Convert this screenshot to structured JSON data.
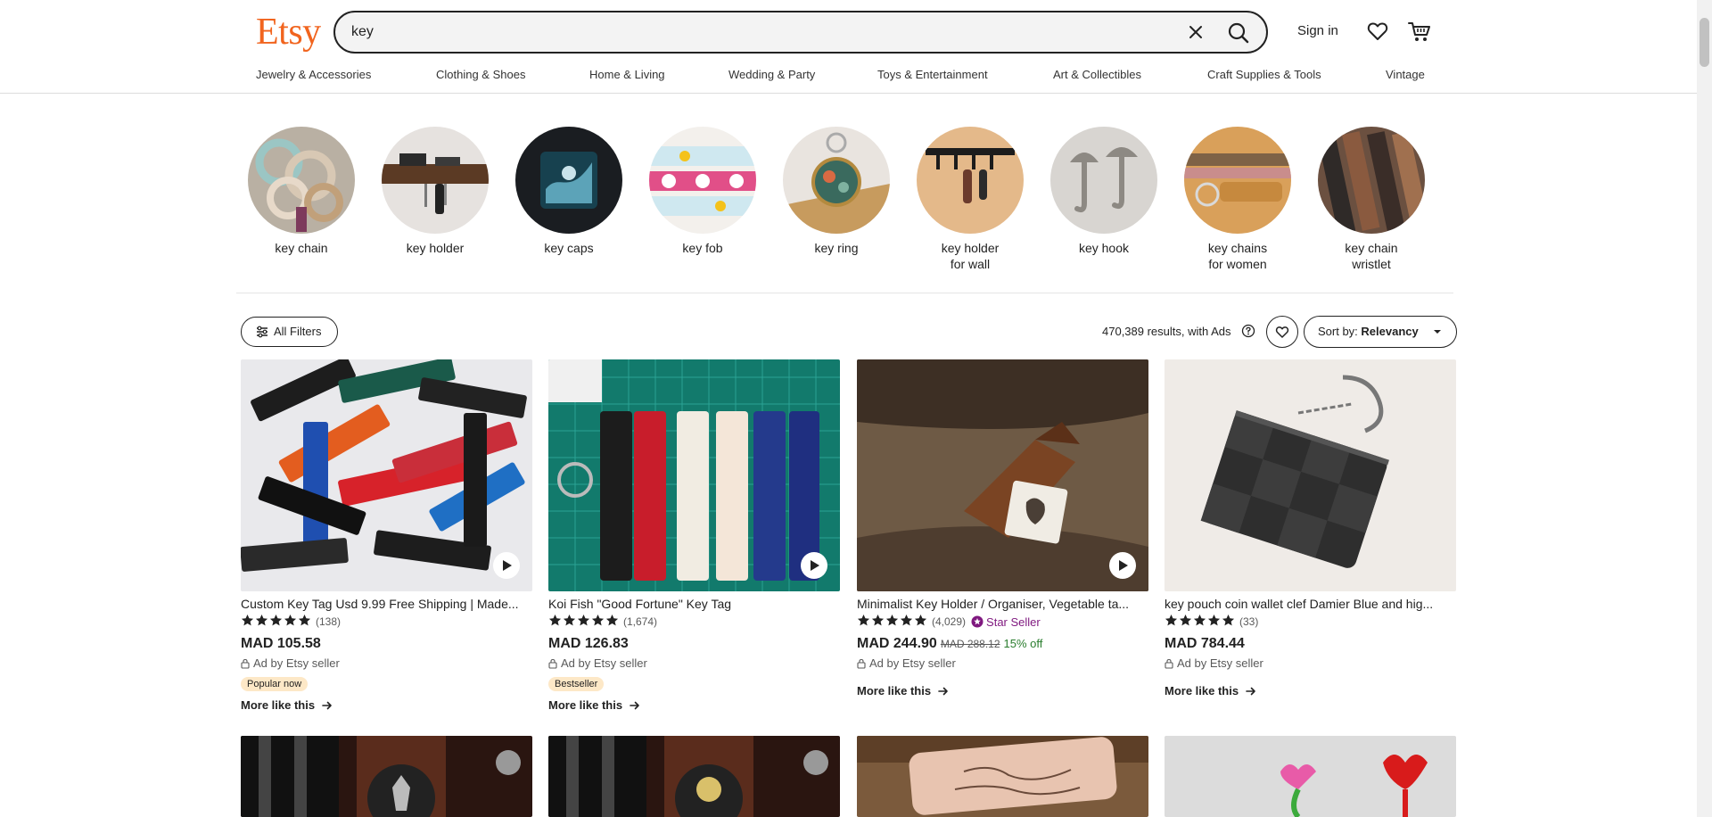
{
  "header": {
    "logo": "Etsy",
    "search_value": "key",
    "signin_label": "Sign in"
  },
  "nav": [
    "Jewelry & Accessories",
    "Clothing & Shoes",
    "Home & Living",
    "Wedding & Party",
    "Toys & Entertainment",
    "Art & Collectibles",
    "Craft Supplies & Tools",
    "Vintage"
  ],
  "categories": [
    {
      "line1": "key chain",
      "line2": ""
    },
    {
      "line1": "key holder",
      "line2": ""
    },
    {
      "line1": "key caps",
      "line2": ""
    },
    {
      "line1": "key fob",
      "line2": ""
    },
    {
      "line1": "key ring",
      "line2": ""
    },
    {
      "line1": "key holder",
      "line2": "for wall"
    },
    {
      "line1": "key hook",
      "line2": ""
    },
    {
      "line1": "key chains",
      "line2": "for women"
    },
    {
      "line1": "key chain",
      "line2": "wristlet"
    }
  ],
  "filters": {
    "all_filters_label": "All Filters",
    "results_text": "470,389 results, with Ads",
    "sort_prefix": "Sort by:",
    "sort_value": "Relevancy"
  },
  "products": [
    {
      "title": "Custom Key Tag Usd 9.99 Free Shipping | Made...",
      "reviews": "(138)",
      "price": "MAD 105.58",
      "ad_text": "Ad by Etsy seller",
      "badge": "Popular now",
      "more": "More like this",
      "rating": 5
    },
    {
      "title": "Koi Fish \"Good Fortune\" Key Tag",
      "reviews": "(1,674)",
      "price": "MAD 126.83",
      "ad_text": "Ad by Etsy seller",
      "badge": "Bestseller",
      "more": "More like this",
      "rating": 5
    },
    {
      "title": "Minimalist Key Holder / Organiser, Vegetable ta...",
      "reviews": "(4,029)",
      "star_seller": "Star Seller",
      "price": "MAD 244.90",
      "old_price": "MAD 288.12",
      "discount": "15% off",
      "ad_text": "Ad by Etsy seller",
      "more": "More like this",
      "rating": 5
    },
    {
      "title": "key pouch coin wallet clef Damier Blue and hig...",
      "reviews": "(33)",
      "price": "MAD 784.44",
      "ad_text": "Ad by Etsy seller",
      "more": "More like this",
      "rating": 5
    }
  ],
  "icons": {
    "clear": "close-icon",
    "search": "search-icon",
    "favorites": "heart-icon",
    "cart": "cart-icon",
    "filters": "sliders-icon",
    "help": "help-circle-icon",
    "play": "play-icon",
    "ad": "lock-icon",
    "more": "arrow-right-icon"
  },
  "colors": {
    "brand": "#f1641e",
    "star_seller": "#7f187f",
    "discount": "#2a7d2e",
    "badge_bg": "#fde8c7"
  }
}
